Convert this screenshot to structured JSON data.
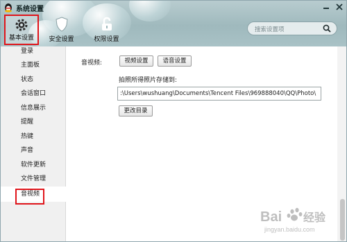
{
  "window": {
    "title": "系统设置"
  },
  "tabs": [
    {
      "label": "基本设置"
    },
    {
      "label": "安全设置"
    },
    {
      "label": "权限设置"
    }
  ],
  "search": {
    "placeholder": "搜索设置项"
  },
  "sidebar": {
    "items": [
      {
        "label": "登录"
      },
      {
        "label": "主面板"
      },
      {
        "label": "状态"
      },
      {
        "label": "会话窗口"
      },
      {
        "label": "信息展示"
      },
      {
        "label": "提醒"
      },
      {
        "label": "热键"
      },
      {
        "label": "声音"
      },
      {
        "label": "软件更新"
      },
      {
        "label": "文件管理"
      },
      {
        "label": "音视频"
      }
    ]
  },
  "av": {
    "section_label": "音视频:",
    "video_button": "视频设置",
    "audio_button": "语音设置",
    "save_label": "拍照所得照片存储到:",
    "path": ":\\Users\\wushuang\\Documents\\Tencent Files\\969888040\\QQ\\Photo\\",
    "change_dir_button": "更改目录"
  },
  "watermark": {
    "text": "Bai经验",
    "url": "jingyan.baidu.com"
  },
  "colors": {
    "accent_highlight": "#e0141a",
    "header": "#a9c2c6"
  }
}
